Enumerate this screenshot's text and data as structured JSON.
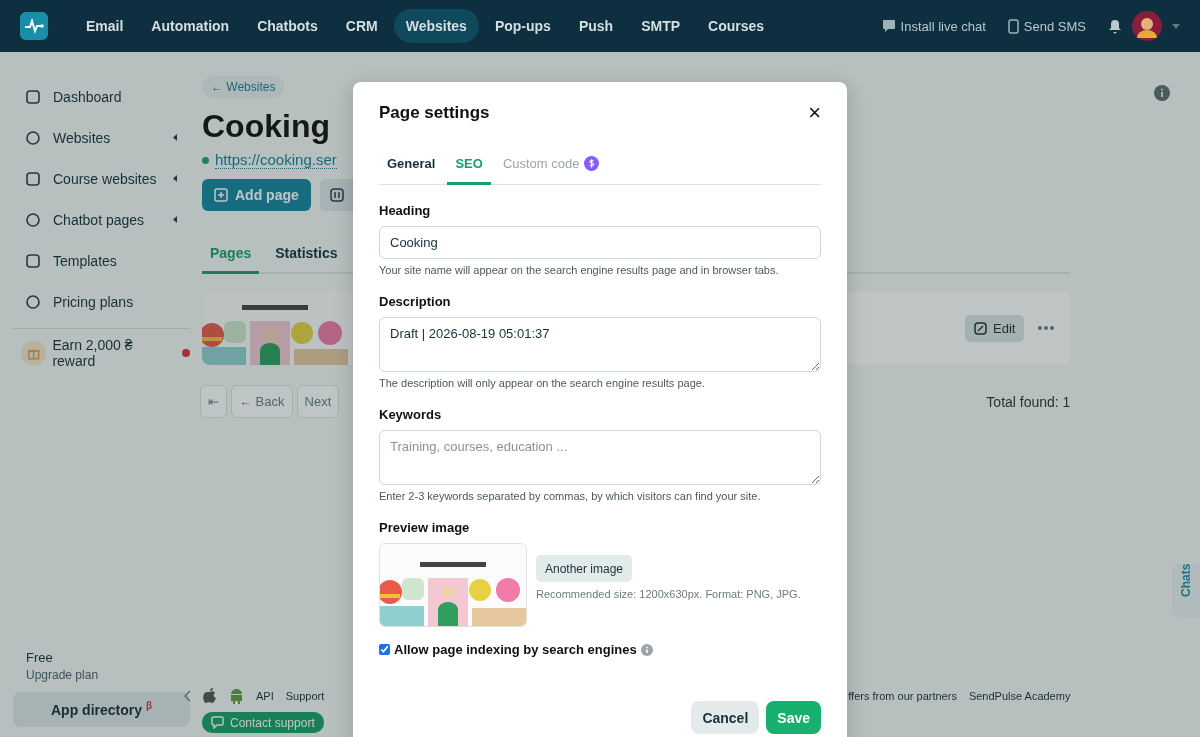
{
  "nav": {
    "items": [
      {
        "label": "Email",
        "selected": false
      },
      {
        "label": "Automation",
        "selected": false
      },
      {
        "label": "Chatbots",
        "selected": false
      },
      {
        "label": "CRM",
        "selected": false
      },
      {
        "label": "Websites",
        "selected": true
      },
      {
        "label": "Pop-ups",
        "selected": false
      },
      {
        "label": "Push",
        "selected": false
      },
      {
        "label": "SMTP",
        "selected": false
      },
      {
        "label": "Courses",
        "selected": false
      }
    ],
    "actions": [
      "Install live chat",
      "Send SMS"
    ]
  },
  "sidebar": {
    "items": [
      {
        "label": "Dashboard",
        "submenu": false
      },
      {
        "label": "Websites",
        "submenu": true
      },
      {
        "label": "Course websites",
        "submenu": true
      },
      {
        "label": "Chatbot pages",
        "submenu": true
      },
      {
        "label": "Templates",
        "submenu": false
      },
      {
        "label": "Pricing plans",
        "submenu": false
      }
    ],
    "promo": "Earn 2,000 ₴ reward",
    "plan": "Free",
    "upgrade": "Upgrade plan",
    "app_directory": "App directory $^{β}$"
  },
  "main": {
    "back": "← Websites",
    "title": "Cooking",
    "url": "https://cooking.ser",
    "add_page": "Add page",
    "tabs": [
      {
        "label": "Pages",
        "selected": true
      },
      {
        "label": "Statistics",
        "selected": false
      }
    ],
    "page_card": {
      "kind": "picture",
      "edit": "Edit"
    },
    "pagination": {
      "first": "⇤",
      "back": "← Back",
      "next": "Next"
    },
    "total": "Total found: 1"
  },
  "footer": {
    "left_links": [
      "API",
      "Support"
    ],
    "right_links": [
      "ffers from our partners",
      "SendPulse Academy"
    ],
    "contact": "Contact support"
  },
  "chats_tab": "Chats",
  "modal": {
    "title": "Page settings",
    "close": "×",
    "tabs": [
      {
        "label": "General",
        "selected": false,
        "disabled": false
      },
      {
        "label": "SEO",
        "selected": true,
        "disabled": false
      },
      {
        "label": "Custom code",
        "selected": false,
        "disabled": true
      }
    ],
    "heading": {
      "label": "Heading",
      "value": "Cooking",
      "hint": "Your site name will appear on the search engine results page and in browser tabs."
    },
    "description": {
      "label": "Description",
      "value": "Draft | 2026-08-19 05:01:37",
      "hint": "The description will only appear on the search engine results page."
    },
    "keywords": {
      "label": "Keywords",
      "placeholder": "Training, courses, education ...",
      "hint": "Enter 2-3 keywords separated by commas, by which visitors can find your site."
    },
    "preview": {
      "label": "Preview image",
      "kind": "picture",
      "button": "Another image",
      "note": "Recommended size: 1200x630px. Format: PNG, JPG."
    },
    "indexing": {
      "label": "Allow page indexing by search engines",
      "checked": true
    },
    "buttons": {
      "cancel": "Cancel",
      "save": "Save"
    }
  }
}
